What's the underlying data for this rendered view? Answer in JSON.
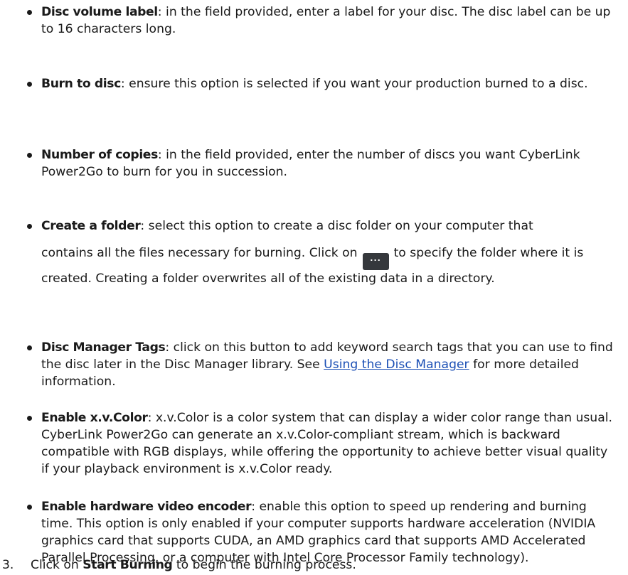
{
  "items": [
    {
      "term": "Disc volume label",
      "text": ": in the field provided, enter a label for your disc. The disc label can be up to 16 characters long."
    },
    {
      "term": "Burn to disc",
      "text": ": ensure this option is selected if you want your production burned to a disc."
    },
    {
      "term": "Number of copies",
      "text": ": in the field provided, enter the number of discs you want CyberLink Power2Go to burn for you in succession."
    },
    {
      "term": "Create a folder",
      "text_a": ": select this option to create a disc folder on your computer that",
      "text_b": "contains all the files necessary for burning. Click on",
      "button_icon": "...",
      "text_c": "to specify the folder where it is created. Creating a folder overwrites all of the existing data in a directory."
    },
    {
      "term": "Disc Manager Tags",
      "text": ": click on this button to add keyword search tags that you can use to find the disc later in the Disc Manager library. See",
      "link": "Using the Disc Manager",
      "text_after": "for more detailed information."
    },
    {
      "term": "Enable x.v.Color",
      "text": ": x.v.Color is a color system that can display a wider color range than usual. CyberLink Power2Go can generate an x.v.Color-compliant stream, which is backward compatible with RGB displays, while offering the opportunity to achieve better visual quality if your playback environment is x.v.Color ready."
    },
    {
      "term": "Enable hardware video encoder",
      "text": ": enable this option to speed up rendering and burning time. This option is only enabled if your computer supports hardware acceleration (NVIDIA graphics card that supports CUDA, an AMD graphics card that supports AMD Accelerated Parallel Processing, or a computer with Intel Core Processor Family technology)."
    }
  ],
  "step": {
    "number": "3.",
    "text_before": "Click on",
    "term": "Start Burning",
    "text_after": "to begin the burning process."
  }
}
